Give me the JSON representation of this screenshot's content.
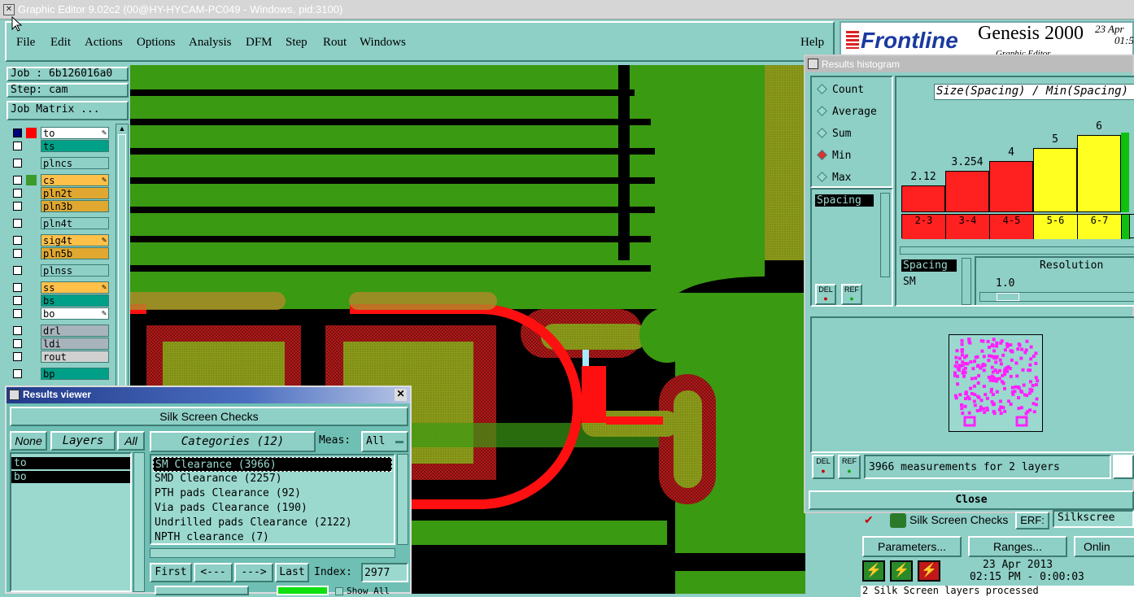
{
  "window": {
    "title": "Graphic Editor 9.02c2 (00@HY-HYCAM-PC049 - Windows, pid:3100)"
  },
  "menu": {
    "items": [
      "File",
      "Edit",
      "Actions",
      "Options",
      "Analysis",
      "DFM",
      "Step",
      "Rout",
      "Windows"
    ],
    "help": "Help"
  },
  "logo": {
    "brand": "Frontline",
    "product": "Genesis 2000",
    "date": "23 Apr",
    "time": "01:5",
    "sub": "Graphic Editor"
  },
  "left": {
    "job": "Job : 6b126016a0",
    "step": "Step: cam",
    "job_matrix": "Job Matrix ...",
    "layers": [
      {
        "name": "to",
        "checked": true,
        "swatch": "#ff0000",
        "bg": "#ffffff",
        "edit": true
      },
      {
        "name": "ts",
        "checked": false,
        "swatch": "",
        "bg": "#00a088",
        "edit": false
      },
      {
        "name": "plncs",
        "checked": false,
        "swatch": "",
        "bg": "#8ecfc6",
        "edit": false
      },
      {
        "name": "cs",
        "checked": false,
        "swatch": "#3a9a2a",
        "bg": "#ffc04a",
        "edit": true
      },
      {
        "name": "pln2t",
        "checked": false,
        "swatch": "",
        "bg": "#e0a830",
        "edit": false
      },
      {
        "name": "pln3b",
        "checked": false,
        "swatch": "",
        "bg": "#e0a830",
        "edit": false
      },
      {
        "name": "pln4t",
        "checked": false,
        "swatch": "",
        "bg": "#8ecfc6",
        "edit": false
      },
      {
        "name": "sig4t",
        "checked": false,
        "swatch": "",
        "bg": "#ffc04a",
        "edit": true
      },
      {
        "name": "pln5b",
        "checked": false,
        "swatch": "",
        "bg": "#e0a830",
        "edit": false
      },
      {
        "name": "plnss",
        "checked": false,
        "swatch": "",
        "bg": "#8ecfc6",
        "edit": false
      },
      {
        "name": "ss",
        "checked": false,
        "swatch": "",
        "bg": "#ffc04a",
        "edit": true
      },
      {
        "name": "bs",
        "checked": false,
        "swatch": "",
        "bg": "#00a088",
        "edit": false
      },
      {
        "name": "bo",
        "checked": false,
        "swatch": "",
        "bg": "#ffffff",
        "edit": true
      },
      {
        "name": "drl",
        "checked": false,
        "swatch": "",
        "bg": "#a8b4bc",
        "edit": false
      },
      {
        "name": "ldi",
        "checked": false,
        "swatch": "",
        "bg": "#a8b4bc",
        "edit": false
      },
      {
        "name": "rout",
        "checked": false,
        "swatch": "",
        "bg": "#d0d0d0",
        "edit": false
      },
      {
        "name": "bp",
        "checked": false,
        "swatch": "",
        "bg": "#00a088",
        "edit": false
      }
    ]
  },
  "results_viewer": {
    "title": "Results viewer",
    "header": "Silk Screen Checks",
    "none_label": "None",
    "layers_label": "Layers",
    "all_label": "All",
    "layers": [
      "to",
      "bo"
    ],
    "categories_label": "Categories (12)",
    "meas_label": "Meas:",
    "meas_value": "All",
    "categories": [
      "SM Clearance (3966)",
      "SMD Clearance (2257)",
      "PTH pads Clearance (92)",
      "Via pads Clearance (190)",
      "Undrilled pads Clearance (2122)",
      "NPTH clearance (7)"
    ],
    "first": "First",
    "prev": "<---",
    "next": "--->",
    "last": "Last",
    "index_label": "Index:",
    "index_value": "2977",
    "show_all": "Show All"
  },
  "histogram": {
    "title": "Results histogram",
    "modes": [
      "Count",
      "Average",
      "Sum",
      "Min",
      "Max"
    ],
    "selected_mode": "Min",
    "chart_title": "Size(Spacing) / Min(Spacing)",
    "list_item": "Spacing",
    "del": "DEL",
    "ref": "REF",
    "spacing_label": "Spacing",
    "sm_label": "SM",
    "resolution_label": "Resolution",
    "resolution_value": "1.0",
    "measurements": "3966 measurements for 2 layers",
    "close": "Close"
  },
  "chart_data": {
    "type": "bar",
    "title": "Size(Spacing) / Min(Spacing)",
    "categories": [
      "2-3",
      "3-4",
      "4-5",
      "5-6",
      "6-7"
    ],
    "values": [
      2.12,
      3.254,
      4,
      5,
      6
    ],
    "value_labels": [
      "2.12",
      "3.254",
      "4",
      "5",
      "6"
    ],
    "colors": [
      "#ff2020",
      "#ff2020",
      "#ff2020",
      "#ffff20",
      "#ffff20"
    ],
    "ylim": [
      0,
      8
    ]
  },
  "silk": {
    "check_name": "Silk Screen Checks",
    "erf_label": "ERF:",
    "erf_value": "Silkscree",
    "parameters": "Parameters...",
    "ranges": "Ranges...",
    "online": "Onlin",
    "date": "23 Apr 2013",
    "time": "02:15 PM - 0:00:03",
    "status": "2 Silk Screen layers processed"
  }
}
